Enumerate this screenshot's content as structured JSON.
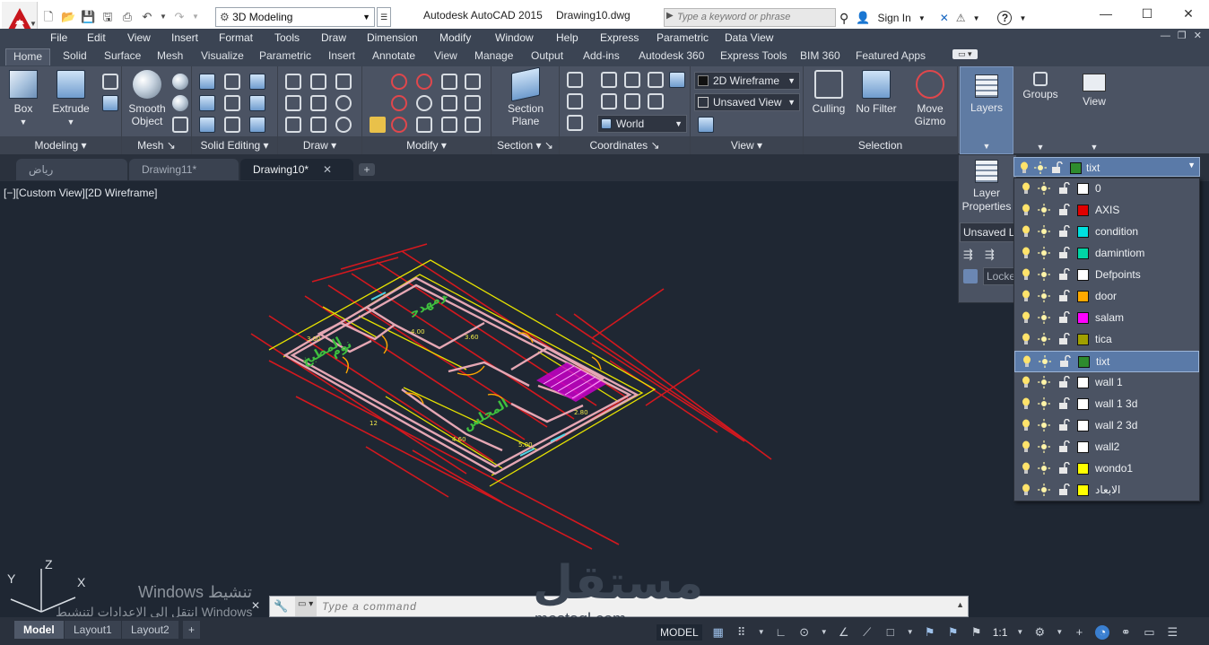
{
  "titlebar": {
    "workspace": "3D Modeling",
    "app_title": "Autodesk AutoCAD 2015",
    "doc_title": "Drawing10.dwg",
    "search_placeholder": "Type a keyword or phrase",
    "sign_in": "Sign In"
  },
  "menu": [
    "File",
    "Edit",
    "View",
    "Insert",
    "Format",
    "Tools",
    "Draw",
    "Dimension",
    "Modify",
    "Window",
    "Help",
    "Express",
    "Parametric",
    "Data View"
  ],
  "ribbon_tabs": [
    "Home",
    "Solid",
    "Surface",
    "Mesh",
    "Visualize",
    "Parametric",
    "Insert",
    "Annotate",
    "View",
    "Manage",
    "Output",
    "Add-ins",
    "Autodesk 360",
    "Express Tools",
    "BIM 360",
    "Featured Apps"
  ],
  "ribbon": {
    "modeling": {
      "title": "Modeling",
      "box": "Box",
      "extrude": "Extrude"
    },
    "mesh": {
      "title": "Mesh",
      "smooth_1": "Smooth",
      "smooth_2": "Object"
    },
    "solid_editing": {
      "title": "Solid Editing"
    },
    "draw": {
      "title": "Draw"
    },
    "modify": {
      "title": "Modify"
    },
    "section": {
      "title": "Section",
      "section_1": "Section",
      "section_2": "Plane"
    },
    "coordinates": {
      "title": "Coordinates",
      "ucs": "World"
    },
    "view": {
      "title": "View",
      "visual_style": "2D Wireframe",
      "named_view": "Unsaved View"
    },
    "selection": {
      "title": "Selection",
      "culling": "Culling",
      "no_filter": "No Filter",
      "move_1": "Move",
      "move_2": "Gizmo"
    },
    "layers": "Layers",
    "groups": "Groups",
    "view_btn": "View"
  },
  "file_tabs": [
    {
      "label": "رياض"
    },
    {
      "label": "Drawing11*"
    },
    {
      "label": "Drawing10*"
    }
  ],
  "viewport_label": "[−][Custom View][2D Wireframe]",
  "layer_panel": {
    "props_1": "Layer",
    "props_2": "Properties",
    "unsaved_state": "Unsaved Layer State",
    "locked": "Locked",
    "current": {
      "name": "tixt",
      "color": "#2e8b2e"
    },
    "layers": [
      {
        "name": "0",
        "color": "#ffffff"
      },
      {
        "name": "AXIS",
        "color": "#e00000"
      },
      {
        "name": "condition",
        "color": "#00e0e0"
      },
      {
        "name": "damintiom",
        "color": "#00d5a5"
      },
      {
        "name": "Defpoints",
        "color": "#ffffff"
      },
      {
        "name": "door",
        "color": "#ffa800"
      },
      {
        "name": "salam",
        "color": "#ff00ff"
      },
      {
        "name": "tica",
        "color": "#a0a000"
      },
      {
        "name": "tixt",
        "color": "#2e8b2e"
      },
      {
        "name": "wall 1",
        "color": "#ffffff"
      },
      {
        "name": "wall 1 3d",
        "color": "#ffffff"
      },
      {
        "name": "wall 2 3d",
        "color": "#ffffff"
      },
      {
        "name": "wall2",
        "color": "#ffffff"
      },
      {
        "name": "wondo1",
        "color": "#ffff00"
      },
      {
        "name": "الابعاد",
        "color": "#ffff00"
      }
    ],
    "selected": "tixt"
  },
  "command": {
    "placeholder": "Type a command"
  },
  "watermark": {
    "line1": "Windows تنشيط",
    "line2": "انتقل إلى الإعدادات لتنشيط Windows",
    "brand": "مستقل",
    "url": "mostaql.com"
  },
  "ucs_labels": {
    "x": "X",
    "y": "Y",
    "z": "Z"
  },
  "layout_tabs": [
    "Model",
    "Layout1",
    "Layout2"
  ],
  "status": {
    "model": "MODEL",
    "scale": "1:1"
  }
}
